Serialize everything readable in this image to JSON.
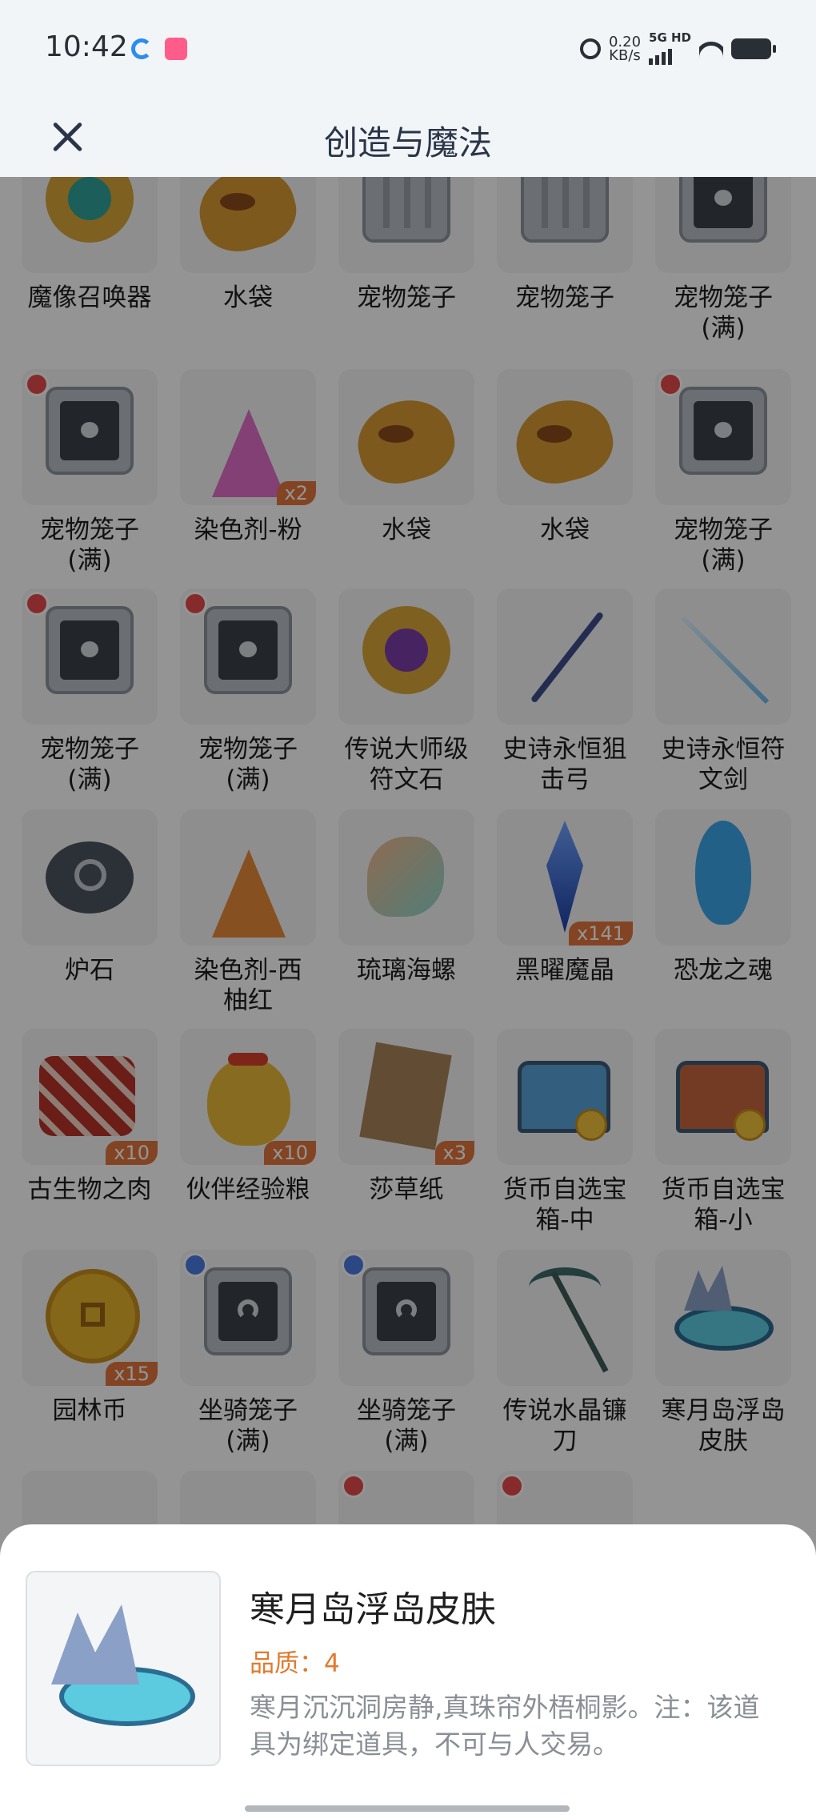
{
  "status": {
    "time": "10:42",
    "speed_value": "0.20",
    "speed_unit": "KB/s",
    "net_type": "5G HD"
  },
  "header": {
    "title": "创造与魔法"
  },
  "items": [
    {
      "name_line1": "魔像召唤器",
      "name_line2": "",
      "count": ""
    },
    {
      "name_line1": "水袋",
      "name_line2": "",
      "count": ""
    },
    {
      "name_line1": "宠物笼子",
      "name_line2": "",
      "count": ""
    },
    {
      "name_line1": "宠物笼子",
      "name_line2": "",
      "count": ""
    },
    {
      "name_line1": "宠物笼子",
      "name_line2": "(满)",
      "count": ""
    },
    {
      "name_line1": "宠物笼子",
      "name_line2": "(满)",
      "count": ""
    },
    {
      "name_line1": "染色剂-粉",
      "name_line2": "",
      "count": "x2"
    },
    {
      "name_line1": "水袋",
      "name_line2": "",
      "count": ""
    },
    {
      "name_line1": "水袋",
      "name_line2": "",
      "count": ""
    },
    {
      "name_line1": "宠物笼子",
      "name_line2": "(满)",
      "count": ""
    },
    {
      "name_line1": "宠物笼子",
      "name_line2": "(满)",
      "count": ""
    },
    {
      "name_line1": "宠物笼子",
      "name_line2": "(满)",
      "count": ""
    },
    {
      "name_line1": "传说大师级",
      "name_line2": "符文石",
      "count": ""
    },
    {
      "name_line1": "史诗永恒狙",
      "name_line2": "击弓",
      "count": ""
    },
    {
      "name_line1": "史诗永恒符",
      "name_line2": "文剑",
      "count": ""
    },
    {
      "name_line1": "炉石",
      "name_line2": "",
      "count": ""
    },
    {
      "name_line1": "染色剂-西",
      "name_line2": "柚红",
      "count": ""
    },
    {
      "name_line1": "琉璃海螺",
      "name_line2": "",
      "count": ""
    },
    {
      "name_line1": "黑曜魔晶",
      "name_line2": "",
      "count": "x141"
    },
    {
      "name_line1": "恐龙之魂",
      "name_line2": "",
      "count": ""
    },
    {
      "name_line1": "古生物之肉",
      "name_line2": "",
      "count": "x10"
    },
    {
      "name_line1": "伙伴经验粮",
      "name_line2": "",
      "count": "x10"
    },
    {
      "name_line1": "莎草纸",
      "name_line2": "",
      "count": "x3"
    },
    {
      "name_line1": "货币自选宝",
      "name_line2": "箱-中",
      "count": ""
    },
    {
      "name_line1": "货币自选宝",
      "name_line2": "箱-小",
      "count": ""
    },
    {
      "name_line1": "园林币",
      "name_line2": "",
      "count": "x15"
    },
    {
      "name_line1": "坐骑笼子",
      "name_line2": "(满)",
      "count": ""
    },
    {
      "name_line1": "坐骑笼子",
      "name_line2": "(满)",
      "count": ""
    },
    {
      "name_line1": "传说水晶镰",
      "name_line2": "刀",
      "count": ""
    },
    {
      "name_line1": "寒月岛浮岛",
      "name_line2": "皮肤",
      "count": ""
    }
  ],
  "detail": {
    "title": "寒月岛浮岛皮肤",
    "quality": "品质：4",
    "description": "寒月沉沉洞房静,真珠帘外梧桐影。注：该道具为绑定道具，不可与人交易。"
  }
}
